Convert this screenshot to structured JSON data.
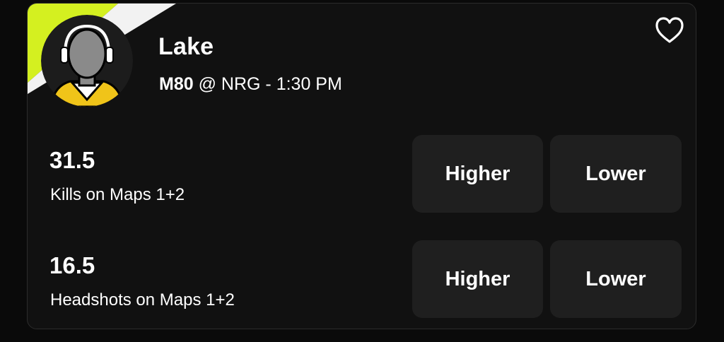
{
  "player": {
    "name": "Lake",
    "team": "M80",
    "matchup_rest": "@ NRG - 1:30 PM",
    "avatar_icon": "player-silhouette-icon"
  },
  "favorite_icon": "heart-outline-icon",
  "props": [
    {
      "line": "31.5",
      "stat": "Kills on Maps 1+2",
      "higher_label": "Higher",
      "lower_label": "Lower"
    },
    {
      "line": "16.5",
      "stat": "Headshots on Maps 1+2",
      "higher_label": "Higher",
      "lower_label": "Lower"
    }
  ],
  "colors": {
    "accent_lime": "#d4f020",
    "jersey_yellow": "#f0c419",
    "card_bg": "#111111",
    "button_bg": "#1f1f1f"
  }
}
